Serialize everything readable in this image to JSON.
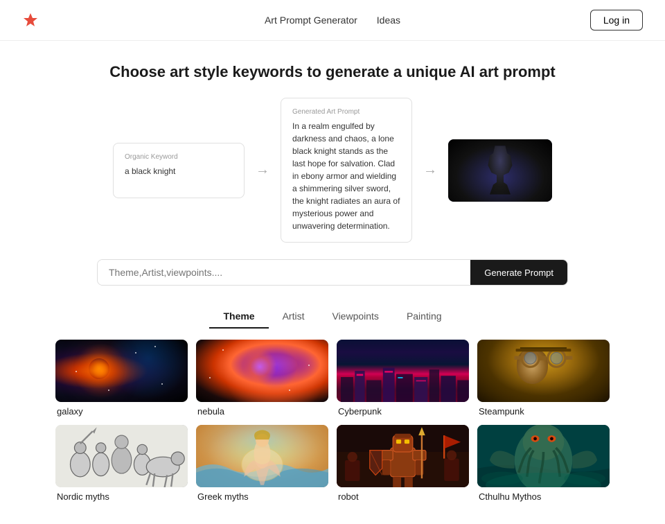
{
  "header": {
    "nav": [
      {
        "label": "Art Prompt Generator",
        "id": "art-prompt-nav"
      },
      {
        "label": "Ideas",
        "id": "ideas-nav"
      }
    ],
    "login_label": "Log in"
  },
  "hero": {
    "title": "Choose art style keywords to generate a unique AI art prompt"
  },
  "demo": {
    "organic_label": "Organic Keyword",
    "organic_value": "a black knight",
    "generated_label": "Generated Art Prompt",
    "generated_text": "In a realm engulfed by darkness and chaos, a lone black knight stands as the last hope for salvation. Clad in ebony armor and wielding a shimmering silver sword, the knight radiates an aura of mysterious power and unwavering determination."
  },
  "search": {
    "placeholder": "Theme,Artist,viewpoints....",
    "generate_label": "Generate Prompt"
  },
  "tabs": [
    {
      "label": "Theme",
      "active": true
    },
    {
      "label": "Artist",
      "active": false
    },
    {
      "label": "Viewpoints",
      "active": false
    },
    {
      "label": "Painting",
      "active": false
    }
  ],
  "grid": [
    {
      "label": "galaxy",
      "img_class": "img-galaxy",
      "overlay": "galaxy-overlay"
    },
    {
      "label": "nebula",
      "img_class": "img-nebula",
      "overlay": "nebula-overlay"
    },
    {
      "label": "Cyberpunk",
      "img_class": "img-cyberpunk",
      "overlay": "cyberpunk-overlay"
    },
    {
      "label": "Steampunk",
      "img_class": "img-steampunk",
      "overlay": "steampunk-overlay"
    },
    {
      "label": "Nordic myths",
      "img_class": "img-nordic",
      "overlay": "nordic-overlay"
    },
    {
      "label": "Greek myths",
      "img_class": "img-greek",
      "overlay": "greek-overlay"
    },
    {
      "label": "robot",
      "img_class": "img-robot",
      "overlay": "robot-overlay"
    },
    {
      "label": "Cthulhu Mythos",
      "img_class": "img-cthulhu",
      "overlay": "cthulhu-overlay"
    }
  ]
}
